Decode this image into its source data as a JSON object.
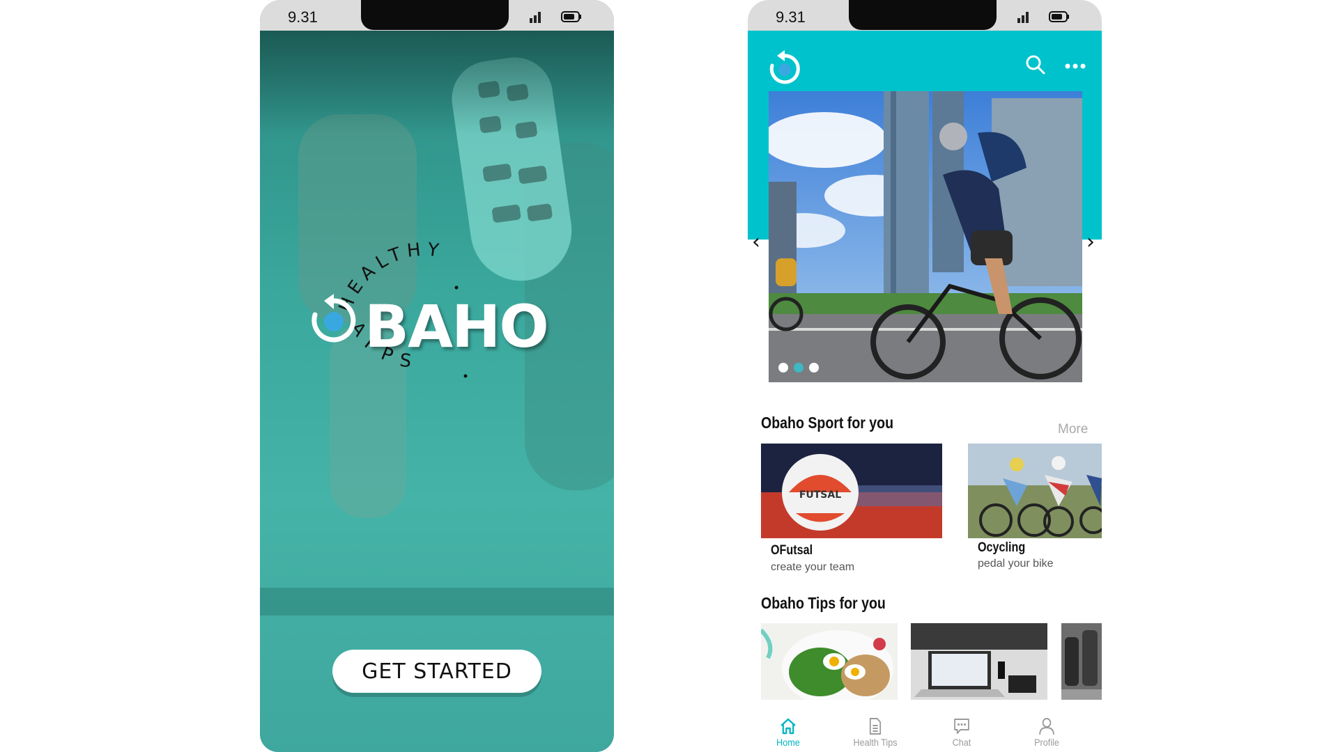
{
  "status": {
    "time": "9.31"
  },
  "splash": {
    "logo_word": "BAHO",
    "arc_top": "HEALTHY",
    "arc_bottom": "APPS",
    "cta_label": "GET STARTED"
  },
  "home": {
    "carousel": {
      "prev": "‹",
      "next": "›",
      "slides": 3,
      "active_index": 1
    },
    "sport_section": {
      "title": "Obaho Sport for you",
      "more_label": "More",
      "cards": [
        {
          "title": "OFutsal",
          "subtitle": "create your team",
          "ball_text": "FUTSAL"
        },
        {
          "title": "Ocycling",
          "subtitle": "pedal your bike"
        }
      ]
    },
    "tips_section": {
      "title": "Obaho Tips for you"
    },
    "nav": [
      {
        "label": "Home",
        "icon": "home-icon",
        "active": true
      },
      {
        "label": "Health Tips",
        "icon": "document-icon",
        "active": false
      },
      {
        "label": "Chat",
        "icon": "chat-icon",
        "active": false
      },
      {
        "label": "Profile",
        "icon": "profile-icon",
        "active": false
      }
    ]
  },
  "colors": {
    "accent": "#00c2cc",
    "splash_teal": "#3fa8a0",
    "nav_active": "#00b6c2"
  }
}
